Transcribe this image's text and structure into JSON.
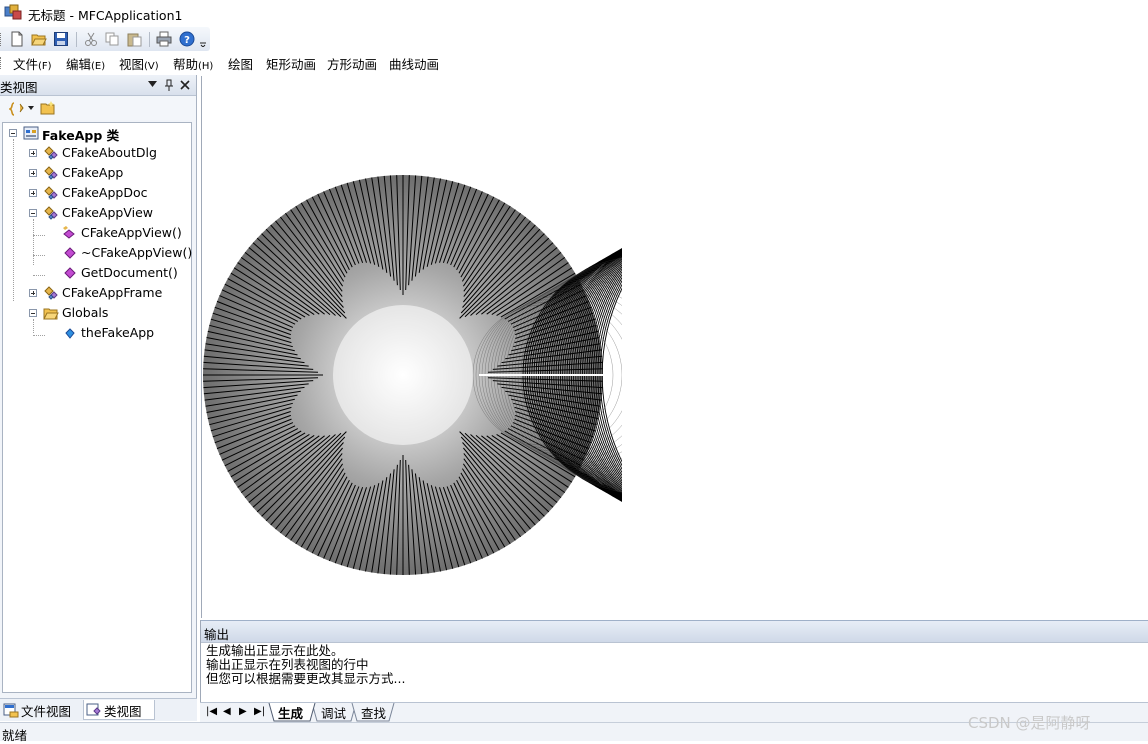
{
  "window": {
    "title": "无标题 - MFCApplication1"
  },
  "menu": [
    {
      "label": "文件",
      "accel": "(F)"
    },
    {
      "label": "编辑",
      "accel": "(E)"
    },
    {
      "label": "视图",
      "accel": "(V)"
    },
    {
      "label": "帮助",
      "accel": "(H)"
    },
    {
      "label": "绘图",
      "accel": ""
    },
    {
      "label": "矩形动画",
      "accel": ""
    },
    {
      "label": "方形动画",
      "accel": ""
    },
    {
      "label": "曲线动画",
      "accel": ""
    }
  ],
  "toolbar": {
    "icons": [
      "new-file-icon",
      "open-folder-icon",
      "save-icon",
      "cut-icon",
      "copy-icon",
      "paste-icon",
      "print-icon",
      "help-icon",
      "overflow-chevron-icon"
    ]
  },
  "classview": {
    "title": "类视图",
    "header_icons": [
      "dropdown-arrow-icon",
      "pin-icon",
      "close-icon"
    ],
    "tree": {
      "root": "FakeApp 类",
      "classes": [
        {
          "label": "CFakeAboutDlg",
          "expanded": false
        },
        {
          "label": "CFakeApp",
          "expanded": false
        },
        {
          "label": "CFakeAppDoc",
          "expanded": false
        },
        {
          "label": "CFakeAppView",
          "expanded": true,
          "members": [
            "CFakeAppView()",
            "~CFakeAppView()",
            "GetDocument()"
          ]
        },
        {
          "label": "CFakeAppFrame",
          "expanded": false
        },
        {
          "label": "Globals",
          "expanded": true,
          "members": [
            "theFakeApp"
          ]
        }
      ]
    },
    "tabs": [
      "文件视图",
      "类视图"
    ],
    "active_tab": "类视图"
  },
  "canvas": {
    "description_colors": {
      "line": "#000000",
      "center": "#ffffff",
      "edge": "#7a7a7a"
    }
  },
  "output": {
    "title": "输出",
    "lines": [
      "生成输出正显示在此处。",
      "输出正显示在列表视图的行中",
      "但您可以根据需要更改其显示方式..."
    ],
    "tabs": [
      "生成",
      "调试",
      "查找"
    ],
    "active_tab": "生成"
  },
  "status": {
    "text": "就绪"
  },
  "watermark": "CSDN @是阿静呀"
}
